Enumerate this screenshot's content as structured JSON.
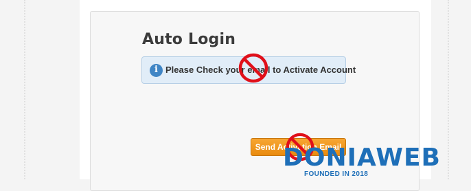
{
  "auto_login": {
    "title": "Auto Login",
    "info_message": "Please Check your email to Activate Account",
    "send_button_label": "Send Activation Email"
  },
  "watermark": {
    "brand": "DONIAWEB",
    "tagline": "FOUNDED IN 2018"
  },
  "icons": {
    "info": "info-icon",
    "prohibited": "no-entry-icon"
  },
  "colors": {
    "alert_bg": "#e1edf8",
    "alert_border": "#b6cfe6",
    "button": "#f0961c",
    "watermark": "#1e6fb8",
    "prohibited_sign": "#e0101a"
  }
}
